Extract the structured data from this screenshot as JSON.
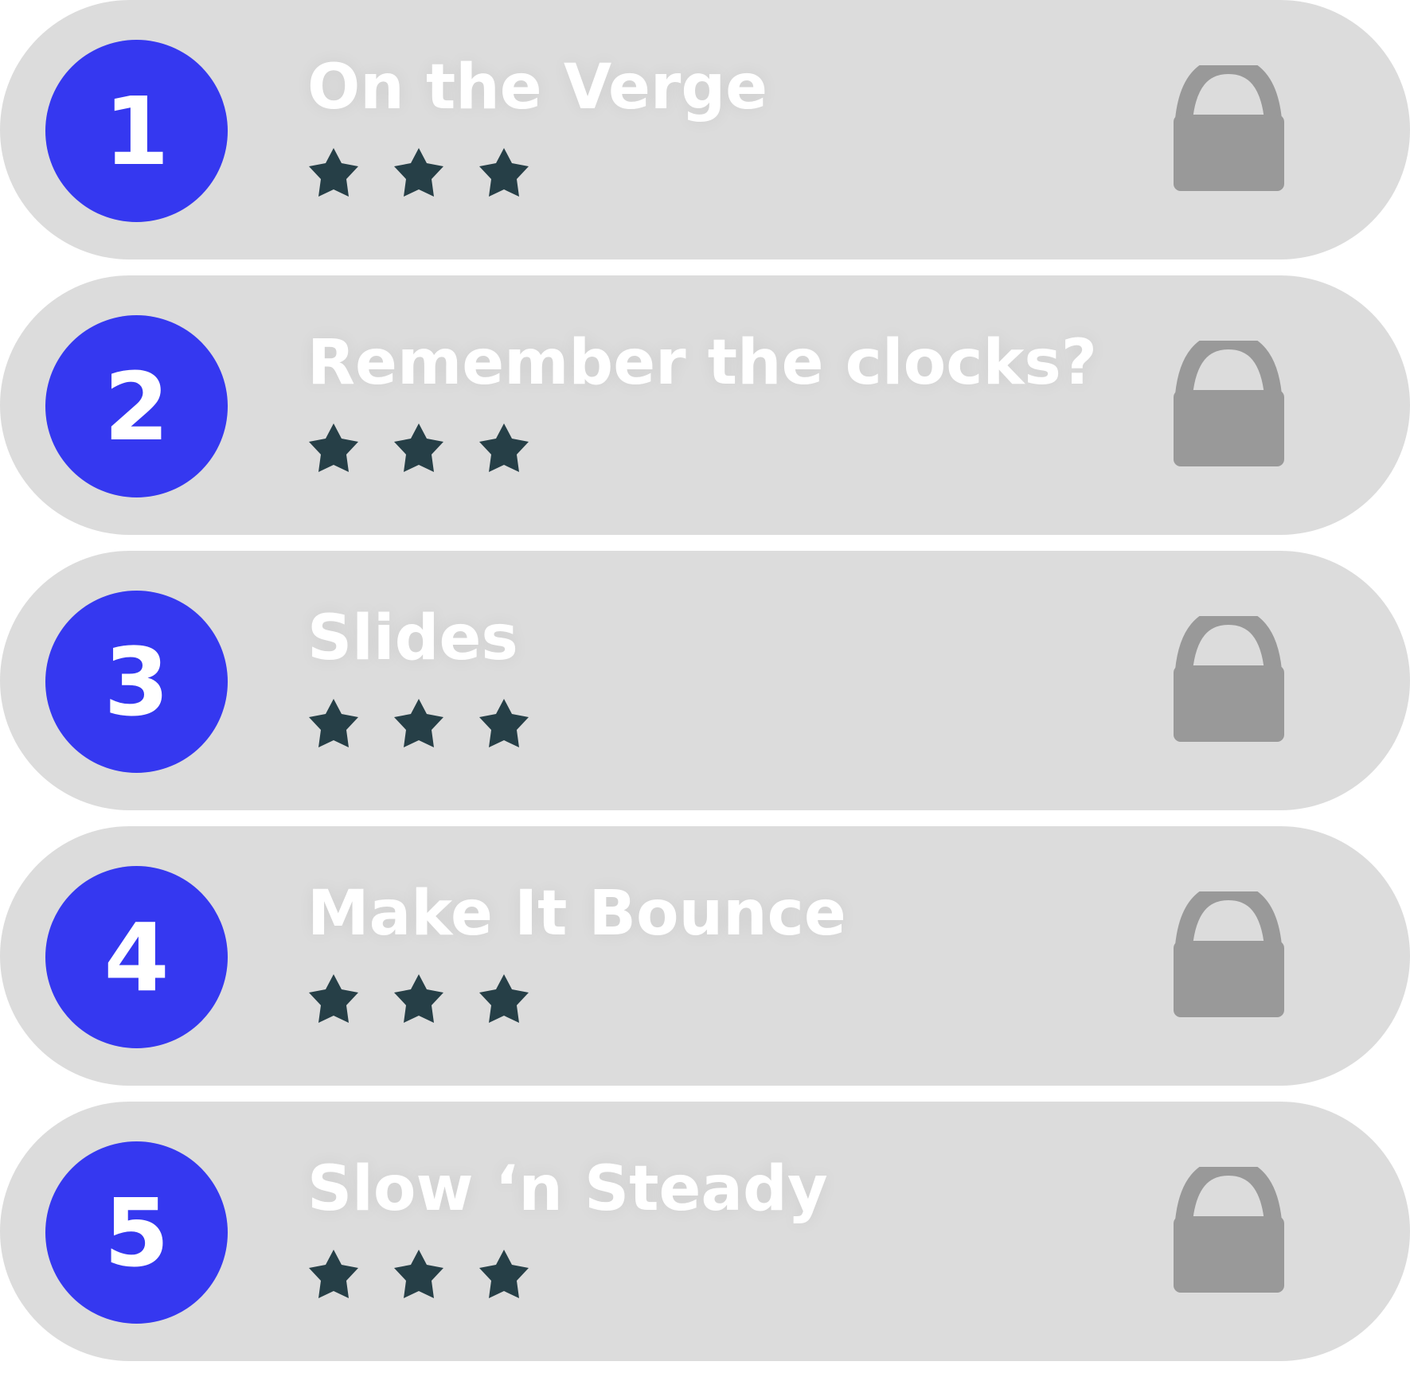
{
  "levels": [
    {
      "number": "1",
      "title": "On the Verge",
      "stars_total": 3,
      "locked": true
    },
    {
      "number": "2",
      "title": "Remember the clocks?",
      "stars_total": 3,
      "locked": true
    },
    {
      "number": "3",
      "title": "Slides",
      "stars_total": 3,
      "locked": true
    },
    {
      "number": "4",
      "title": "Make It Bounce",
      "stars_total": 3,
      "locked": true
    },
    {
      "number": "5",
      "title": "Slow ‘n Steady",
      "stars_total": 3,
      "locked": true
    }
  ],
  "icons": {
    "star": "star-icon",
    "lock": "lock-icon"
  },
  "colors": {
    "row_background": "#dcdcdc",
    "badge": "#3538f0",
    "text": "#ffffff",
    "star": "#263f47",
    "lock": "#999999"
  }
}
